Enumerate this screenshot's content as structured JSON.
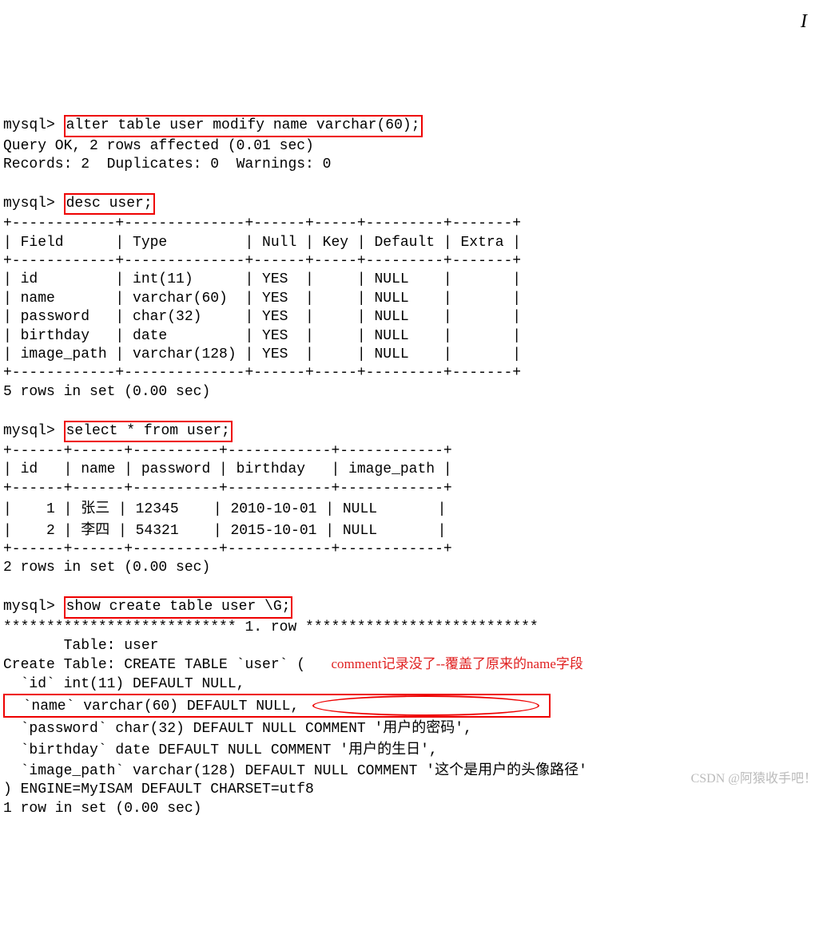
{
  "prompt": "mysql>",
  "cmd1": "alter table user modify name varchar(60);",
  "resp1a": "Query OK, 2 rows affected (0.01 sec)",
  "resp1b": "Records: 2  Duplicates: 0  Warnings: 0",
  "cmd2": "desc user;",
  "desc_border_top": "+------------+--------------+------+-----+---------+-------+",
  "desc_header": "| Field      | Type         | Null | Key | Default | Extra |",
  "desc_rows": [
    "| id         | int(11)      | YES  |     | NULL    |       |",
    "| name       | varchar(60)  | YES  |     | NULL    |       |",
    "| password   | char(32)     | YES  |     | NULL    |       |",
    "| birthday   | date         | YES  |     | NULL    |       |",
    "| image_path | varchar(128) | YES  |     | NULL    |       |"
  ],
  "desc_footer": "5 rows in set (0.00 sec)",
  "cmd3": "select * from user;",
  "sel_border": "+------+------+----------+------------+------------+",
  "sel_header": "| id   | name | password | birthday   | image_path |",
  "sel_rows": [
    {
      "pre": "|    1 | ",
      "cjk": "张三",
      "post": " | 12345    | 2010-10-01 | NULL       |"
    },
    {
      "pre": "|    2 | ",
      "cjk": "李四",
      "post": " | 54321    | 2015-10-01 | NULL       |"
    }
  ],
  "sel_footer": "2 rows in set (0.00 sec)",
  "cmd4": "show create table user \\G;",
  "row_marker": "*************************** 1. row ***************************",
  "ct_table": "       Table: user",
  "ct_head": "Create Table: CREATE TABLE `user` (",
  "ct_id": "  `id` int(11) DEFAULT NULL,",
  "ct_name": "  `name` varchar(60) DEFAULT NULL,",
  "ct_password_pre": "  `password` char(32) DEFAULT NULL COMMENT '",
  "ct_password_cjk": "用户的密码",
  "ct_password_post": "',",
  "ct_birthday_pre": "  `birthday` date DEFAULT NULL COMMENT '",
  "ct_birthday_cjk": "用户的生日",
  "ct_birthday_post": "',",
  "ct_image_pre": "  `image_path` varchar(128) DEFAULT NULL COMMENT '",
  "ct_image_cjk": "这个是用户的头像路径",
  "ct_image_post": "'",
  "ct_engine": ") ENGINE=MyISAM DEFAULT CHARSET=utf8",
  "ct_footer": "1 row in set (0.00 sec)",
  "annotation": "comment记录没了--覆盖了原来的name字段",
  "watermark": "CSDN @阿猿收手吧！"
}
